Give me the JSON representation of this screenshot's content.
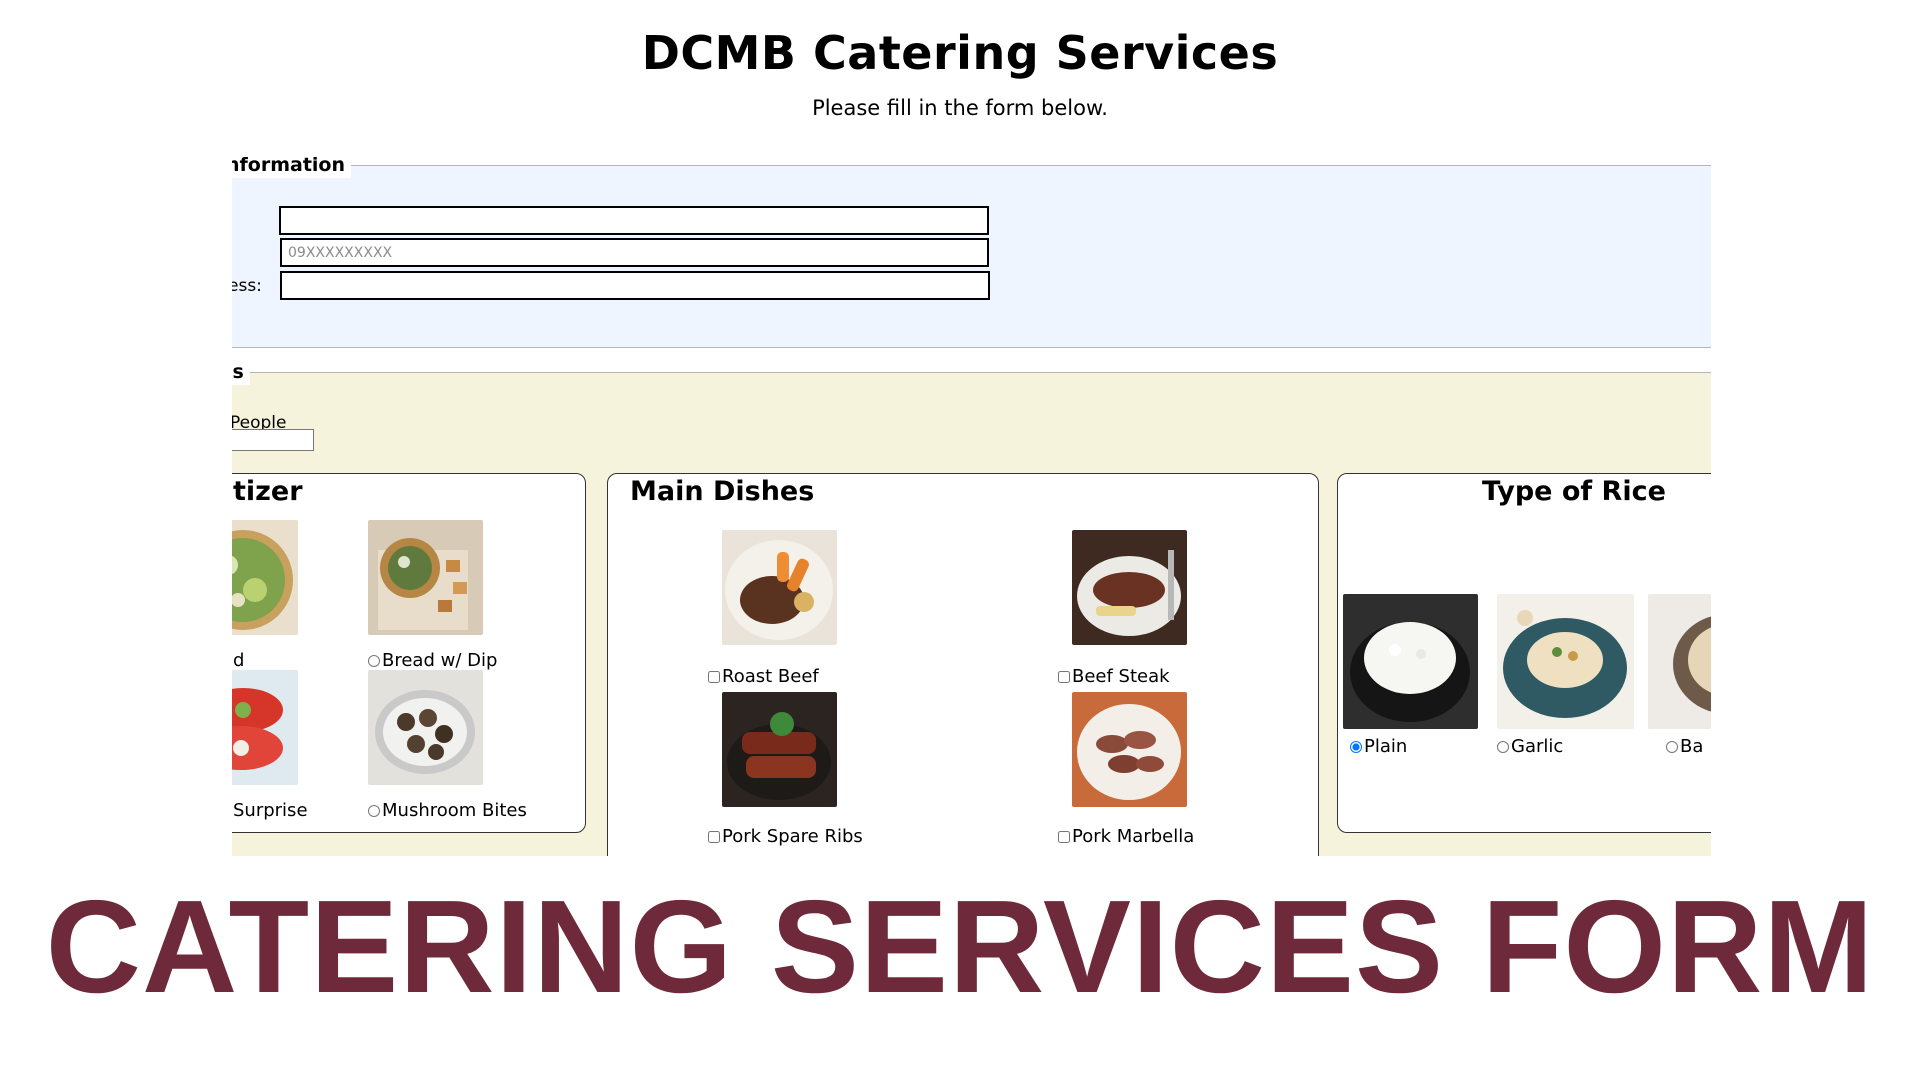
{
  "header": {
    "title": "DCMB Catering Services",
    "subtitle": "Please fill in the form below."
  },
  "personal_info": {
    "legend": "nformation",
    "name_value": "",
    "phone_placeholder": "09XXXXXXXXX",
    "address_label": "ess:",
    "address_value": ""
  },
  "event_details": {
    "legend": "ls",
    "people_label": "People",
    "people_value": ""
  },
  "appetizer": {
    "title": "tizer",
    "options": [
      {
        "label": "d",
        "icon": "salad-photo"
      },
      {
        "label": "Bread w/ Dip",
        "icon": "bread-dip-photo"
      },
      {
        "label": "Surprise",
        "icon": "tomato-photo"
      },
      {
        "label": "Mushroom Bites",
        "icon": "mushroom-photo"
      }
    ]
  },
  "main_dishes": {
    "title": "Main Dishes",
    "options": [
      {
        "label": "Roast Beef",
        "icon": "roast-beef-photo"
      },
      {
        "label": "Beef Steak",
        "icon": "beef-steak-photo"
      },
      {
        "label": "Pork Spare Ribs",
        "icon": "spare-ribs-photo"
      },
      {
        "label": "Pork Marbella",
        "icon": "pork-marbella-photo"
      }
    ]
  },
  "rice": {
    "title": "Type of Rice",
    "options": [
      {
        "label": "Plain",
        "icon": "plain-rice-photo",
        "selected": true
      },
      {
        "label": "Garlic",
        "icon": "garlic-rice-photo",
        "selected": false
      },
      {
        "label": "Ba",
        "icon": "rice-photo",
        "selected": false
      }
    ]
  },
  "banner": {
    "text": "CATERING SERVICES FORM",
    "color": "#6e2a3a"
  }
}
